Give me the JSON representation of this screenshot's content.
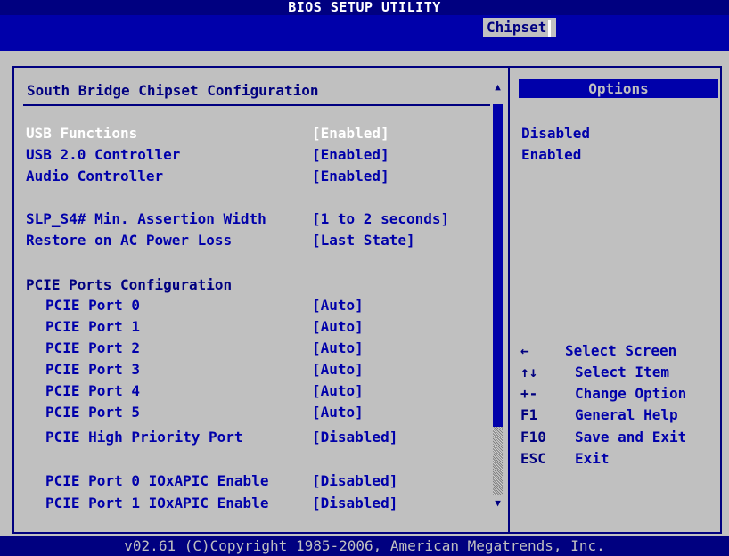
{
  "title": "BIOS SETUP UTILITY",
  "active_tab": "Chipset",
  "panel": {
    "heading": "South Bridge Chipset Configuration",
    "settings_a": [
      {
        "label": "USB Functions",
        "value": "[Enabled]",
        "selected": true
      },
      {
        "label": "USB 2.0 Controller",
        "value": "[Enabled]"
      },
      {
        "label": "Audio Controller",
        "value": "[Enabled]"
      }
    ],
    "settings_b": [
      {
        "label": "SLP_S4# Min. Assertion Width",
        "value": "[1 to 2 seconds]"
      },
      {
        "label": "Restore on AC Power Loss",
        "value": "[Last State]"
      }
    ],
    "pcie_heading": "PCIE Ports Configuration",
    "pcie_settings": [
      {
        "label": "PCIE Port 0",
        "value": "[Auto]"
      },
      {
        "label": "PCIE Port 1",
        "value": "[Auto]"
      },
      {
        "label": "PCIE Port 2",
        "value": "[Auto]"
      },
      {
        "label": "PCIE Port 3",
        "value": "[Auto]"
      },
      {
        "label": "PCIE Port 4",
        "value": "[Auto]"
      },
      {
        "label": "PCIE Port 5",
        "value": "[Auto]"
      },
      {
        "label": "PCIE High Priority Port",
        "value": "[Disabled]"
      }
    ],
    "ioxapic_settings": [
      {
        "label": "PCIE Port 0 IOxAPIC Enable",
        "value": "[Disabled]"
      },
      {
        "label": "PCIE Port 1 IOxAPIC Enable",
        "value": "[Disabled]"
      }
    ]
  },
  "options": {
    "header": "Options",
    "items": [
      "Disabled",
      "Enabled"
    ]
  },
  "help": [
    {
      "key": "←",
      "text": "Select Screen"
    },
    {
      "key": "↑↓",
      "text": "Select Item"
    },
    {
      "key": "+-",
      "text": "Change Option"
    },
    {
      "key": "F1",
      "text": "General Help"
    },
    {
      "key": "F10",
      "text": "Save and Exit"
    },
    {
      "key": "ESC",
      "text": "Exit"
    }
  ],
  "footer": "v02.61 (C)Copyright 1985-2006, American Megatrends, Inc.",
  "colors": {
    "background": "#c0c0c0",
    "header_blue": "#000080",
    "text_blue": "#0000aa",
    "highlight": "#ffffff"
  }
}
